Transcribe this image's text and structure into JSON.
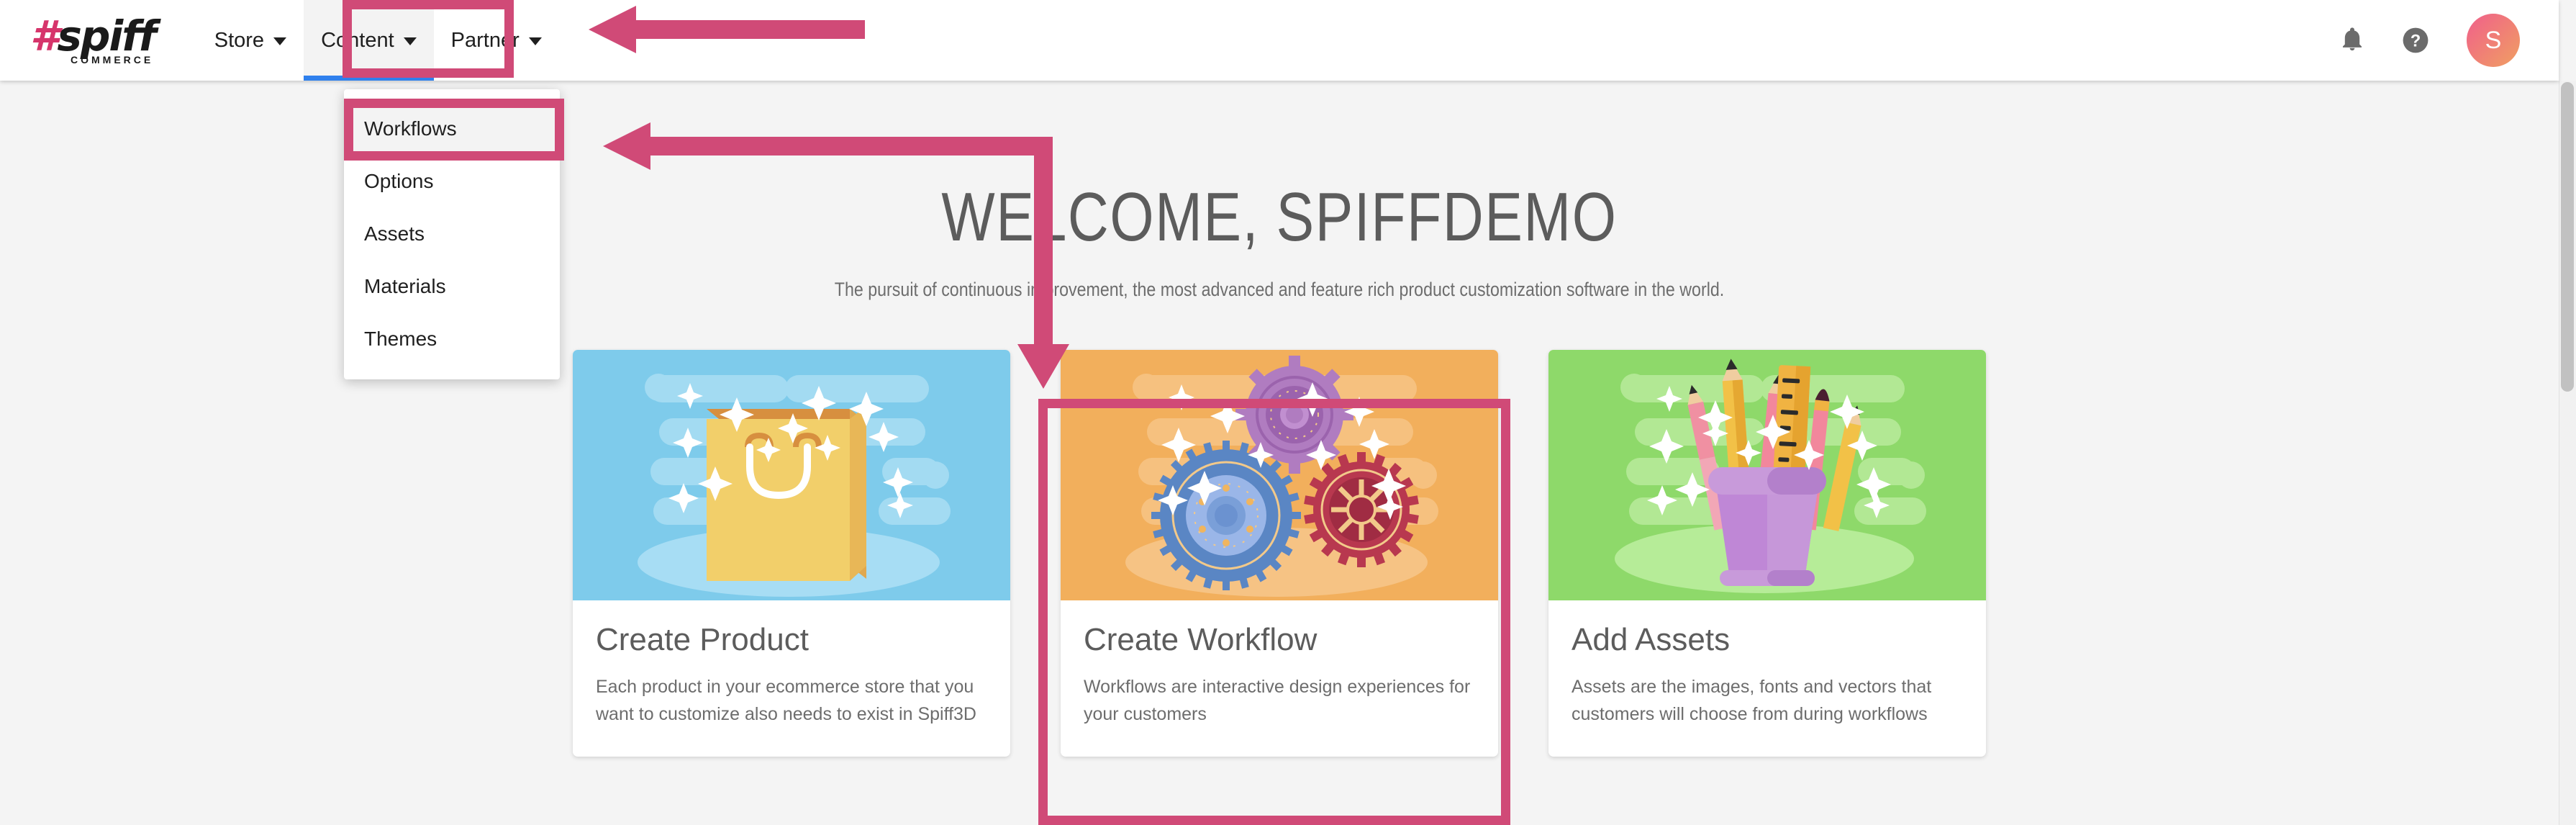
{
  "brand": {
    "logo_hash": "#",
    "logo_word": "spiff",
    "logo_sub": "COMMERCE",
    "accent_pink": "#d6356b",
    "annotation_pink": "#d04a77",
    "active_underline_blue": "#2f80ed"
  },
  "nav": {
    "items": [
      {
        "label": "Store",
        "icon": "chevron-down-icon",
        "active": false
      },
      {
        "label": "Content",
        "icon": "chevron-down-icon",
        "active": true
      },
      {
        "label": "Partner",
        "icon": "chevron-down-icon",
        "active": false
      }
    ],
    "right": {
      "notifications_icon": "bell-icon",
      "help_icon": "question-circle-icon",
      "avatar_initial": "S"
    }
  },
  "dropdown": {
    "open_for": "Content",
    "items": [
      {
        "label": "Workflows",
        "highlighted": true
      },
      {
        "label": "Options",
        "highlighted": false
      },
      {
        "label": "Assets",
        "highlighted": false
      },
      {
        "label": "Materials",
        "highlighted": false
      },
      {
        "label": "Themes",
        "highlighted": false
      }
    ]
  },
  "hero": {
    "title": "WELCOME, SPIFFDEMO",
    "subtitle": "The pursuit of continuous improvement, the most advanced and feature rich product customization software in the world."
  },
  "cards": [
    {
      "title": "Create Product",
      "desc": "Each product in your ecommerce store that you want to customize also needs to exist in Spiff3D",
      "image": "shopping-bag-illustration",
      "bg": "#7ecbeb",
      "highlighted": false
    },
    {
      "title": "Create Workflow",
      "desc": "Workflows are interactive design experiences for your customers",
      "image": "gears-illustration",
      "bg": "#f2af5c",
      "highlighted": true
    },
    {
      "title": "Add Assets",
      "desc": "Assets are the images, fonts and vectors that customers will choose from during workflows",
      "image": "pencil-cup-illustration",
      "bg": "#8ed96a",
      "highlighted": false
    }
  ],
  "annotations": {
    "boxes": [
      "content-nav-item",
      "workflows-menu-item",
      "create-workflow-card"
    ],
    "arrows": [
      "arrow-pointing-to-content-tab",
      "arrow-pointing-to-workflows-item",
      "arrow-pointing-to-create-workflow-card"
    ]
  }
}
